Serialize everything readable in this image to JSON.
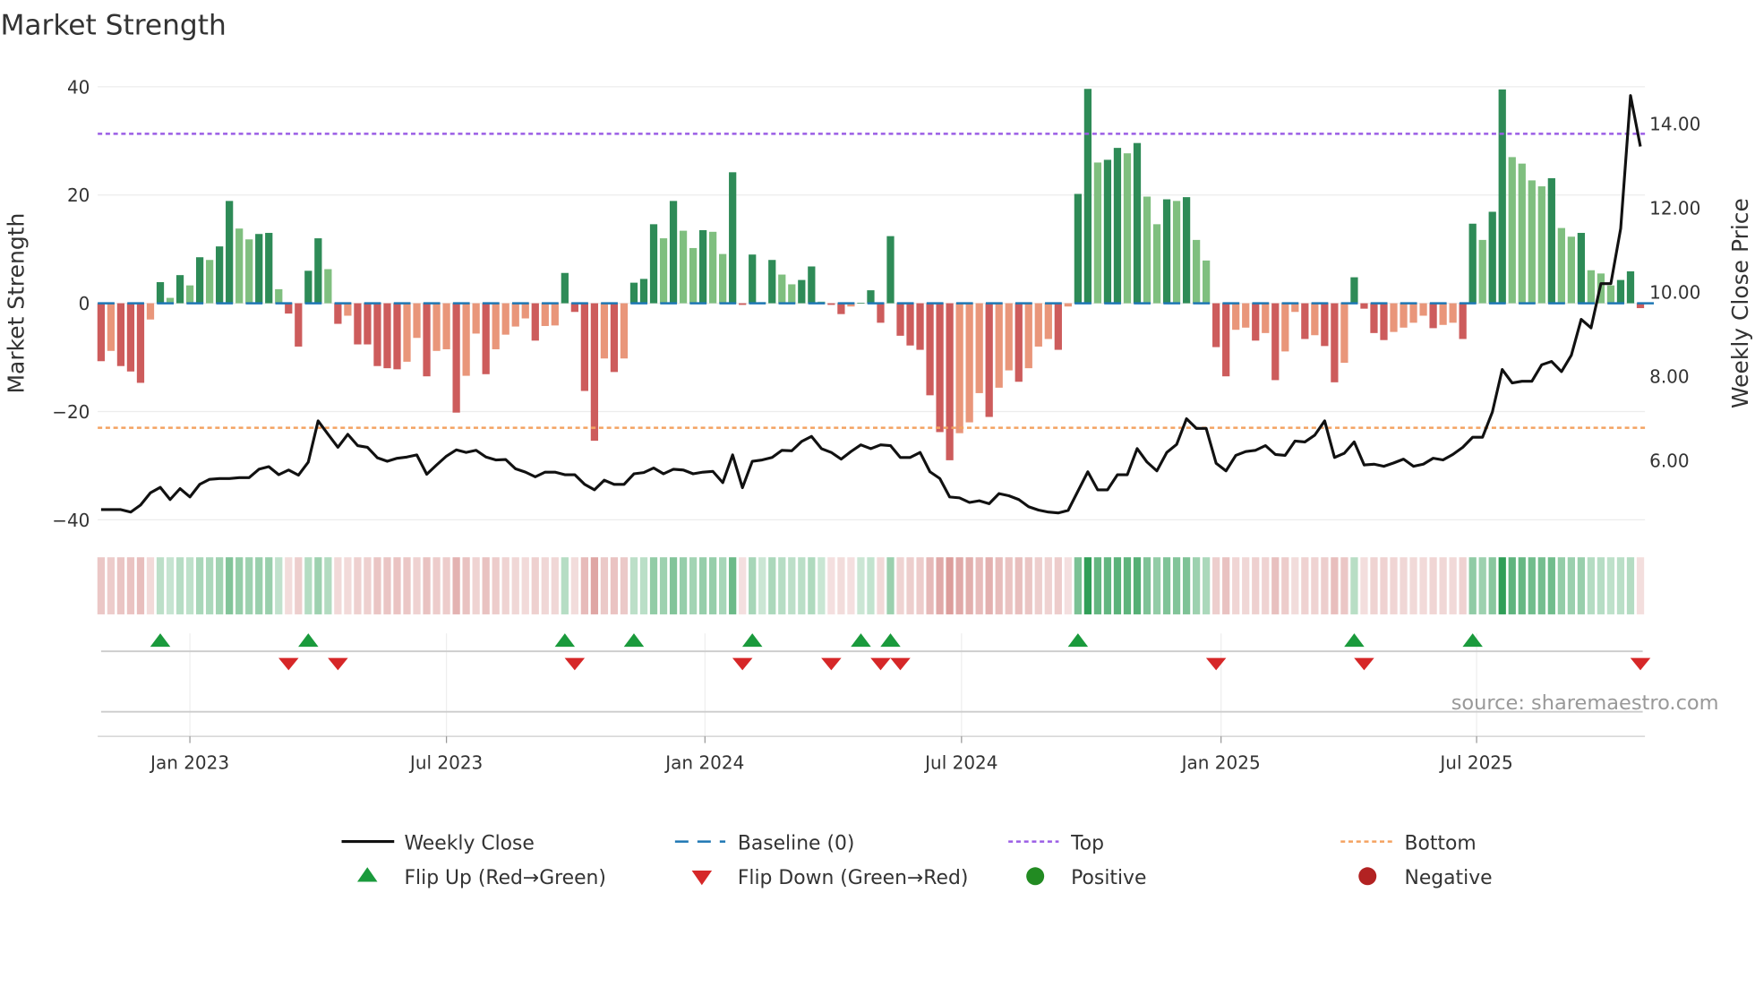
{
  "chart_data": {
    "type": "bar",
    "title": "Market Strength",
    "ylabel": "Market Strength",
    "y2label": "Weekly Close Price",
    "ylim": [
      -40,
      40
    ],
    "y2lim": [
      4.5,
      14.8
    ],
    "yticks": [
      "40",
      "20",
      "0",
      "−20",
      "−40"
    ],
    "yticks_values": [
      40,
      20,
      0,
      -20,
      -40
    ],
    "y2ticks": [
      "14.00",
      "12.00",
      "10.00",
      "8.00",
      "6.00"
    ],
    "y2ticks_values": [
      14,
      12,
      10,
      8,
      6
    ],
    "xticks": [
      "Jan 2023",
      "Jul 2023",
      "Jan 2024",
      "Jul 2024",
      "Jan 2025",
      "Jul 2025"
    ],
    "xticks_week_index": [
      9,
      35,
      61.2,
      87.2,
      113.5,
      139.4
    ],
    "top_level": 31.3,
    "bottom_level": -23,
    "strength": [
      -10.7,
      -8.8,
      -11.6,
      -12.6,
      -14.7,
      -3,
      3.9,
      1,
      5.2,
      3.3,
      8.5,
      8,
      10.5,
      18.9,
      13.8,
      11.8,
      12.8,
      13,
      2.6,
      -1.9,
      -8,
      6,
      12,
      6.3,
      -3.8,
      -2.3,
      -7.6,
      -7.6,
      -11.6,
      -12,
      -12.2,
      -10.8,
      -6.4,
      -13.5,
      -8.8,
      -8.5,
      -20.2,
      -13.4,
      -5.6,
      -13.1,
      -8.5,
      -5.8,
      -4.3,
      -2.8,
      -6.9,
      -4.2,
      -4.1,
      5.6,
      -1.6,
      -16.2,
      -25.4,
      -10.2,
      -12.7,
      -10.2,
      3.8,
      4.5,
      14.6,
      12,
      18.9,
      13.4,
      10.2,
      13.5,
      13.2,
      9.1,
      24.2,
      -0.3,
      9,
      0.2,
      8,
      5.3,
      3.5,
      4.3,
      6.8,
      0.3,
      -0.3,
      -2,
      -0.6,
      0.1,
      2.4,
      -3.6,
      12.4,
      -6,
      -7.8,
      -8.6,
      -17,
      -23.8,
      -29,
      -24,
      -22,
      -16.6,
      -21,
      -15.6,
      -12.4,
      -14.5,
      -12,
      -8,
      -6.6,
      -8.6,
      -0.6,
      20.2,
      39.6,
      26,
      26.5,
      28.7,
      27.7,
      29.6,
      19.7,
      14.6,
      19.2,
      18.9,
      19.6,
      11.7,
      7.9,
      -8.1,
      -13.5,
      -4.9,
      -4.5,
      -6.9,
      -5.5,
      -14.2,
      -8.9,
      -1.6,
      -6.6,
      -5.9,
      -7.9,
      -14.6,
      -11,
      4.8,
      -1,
      -5.5,
      -6.8,
      -5.3,
      -4.5,
      -3.6,
      -2.3,
      -4.6,
      -4,
      -3.6,
      -6.6,
      14.7,
      11.7,
      16.9,
      39.5,
      27,
      25.8,
      22.7,
      21.6,
      23.1,
      13.9,
      12.3,
      13,
      6.1,
      5.5,
      3.3,
      4.3,
      5.9,
      -0.9
    ],
    "weekly_close": [
      4.83,
      4.83,
      4.83,
      4.77,
      4.94,
      5.23,
      5.36,
      5.07,
      5.33,
      5.13,
      5.43,
      5.55,
      5.57,
      5.57,
      5.59,
      5.59,
      5.79,
      5.85,
      5.66,
      5.77,
      5.65,
      5.96,
      6.94,
      6.62,
      6.31,
      6.62,
      6.35,
      6.31,
      6.06,
      5.98,
      6.05,
      6.08,
      6.13,
      5.67,
      5.89,
      6.1,
      6.25,
      6.19,
      6.24,
      6.08,
      6.01,
      6.02,
      5.8,
      5.72,
      5.61,
      5.72,
      5.72,
      5.66,
      5.66,
      5.43,
      5.3,
      5.53,
      5.43,
      5.43,
      5.68,
      5.71,
      5.82,
      5.68,
      5.79,
      5.77,
      5.68,
      5.72,
      5.74,
      5.47,
      6.13,
      5.35,
      5.98,
      6.01,
      6.07,
      6.24,
      6.23,
      6.45,
      6.57,
      6.28,
      6.19,
      6.03,
      6.21,
      6.37,
      6.28,
      6.37,
      6.35,
      6.07,
      6.07,
      6.19,
      5.73,
      5.57,
      5.13,
      5.11,
      5.0,
      5.04,
      4.97,
      5.21,
      5.16,
      5.07,
      4.9,
      4.82,
      4.77,
      4.75,
      4.81,
      5.27,
      5.73,
      5.3,
      5.3,
      5.66,
      5.66,
      6.28,
      5.96,
      5.75,
      6.19,
      6.38,
      6.99,
      6.76,
      6.76,
      5.93,
      5.75,
      6.12,
      6.21,
      6.24,
      6.35,
      6.14,
      6.12,
      6.46,
      6.44,
      6.6,
      6.94,
      6.07,
      6.17,
      6.44,
      5.89,
      5.91,
      5.86,
      5.94,
      6.03,
      5.86,
      5.91,
      6.05,
      6.01,
      6.14,
      6.31,
      6.55,
      6.55,
      7.15,
      8.16,
      7.84,
      7.88,
      7.88,
      8.27,
      8.35,
      8.11,
      8.5,
      9.35,
      9.15,
      10.2,
      10.2,
      11.51,
      14.67,
      13.46
    ],
    "flip_up_week_index": [
      6,
      21,
      47,
      54,
      66,
      77,
      80,
      99,
      127,
      139
    ],
    "flip_down_week_index": [
      19,
      24,
      48,
      65,
      74,
      79,
      81,
      113,
      128,
      156
    ],
    "legend": {
      "weekly_close": "Weekly Close",
      "baseline": "Baseline (0)",
      "top": "Top",
      "bottom": "Bottom",
      "flip_up": "Flip Up (Red→Green)",
      "flip_down": "Flip Down (Green→Red)",
      "positive": "Positive",
      "negative": "Negative"
    },
    "legend_placement": "bottom",
    "source": "source: sharemaestro.com"
  },
  "colors": {
    "pos_strong": "#2e8b57",
    "pos_weak": "#7fbf7f",
    "neg_strong": "#cd5c5c",
    "neg_weak": "#e9967a",
    "top": "#9b5de5",
    "bottom": "#f4a261",
    "baseline": "#1f77b4",
    "flip_up": "#1a9a3c",
    "flip_down": "#d62728",
    "positive": "#228b22",
    "negative": "#b22222",
    "price": "#111111"
  }
}
